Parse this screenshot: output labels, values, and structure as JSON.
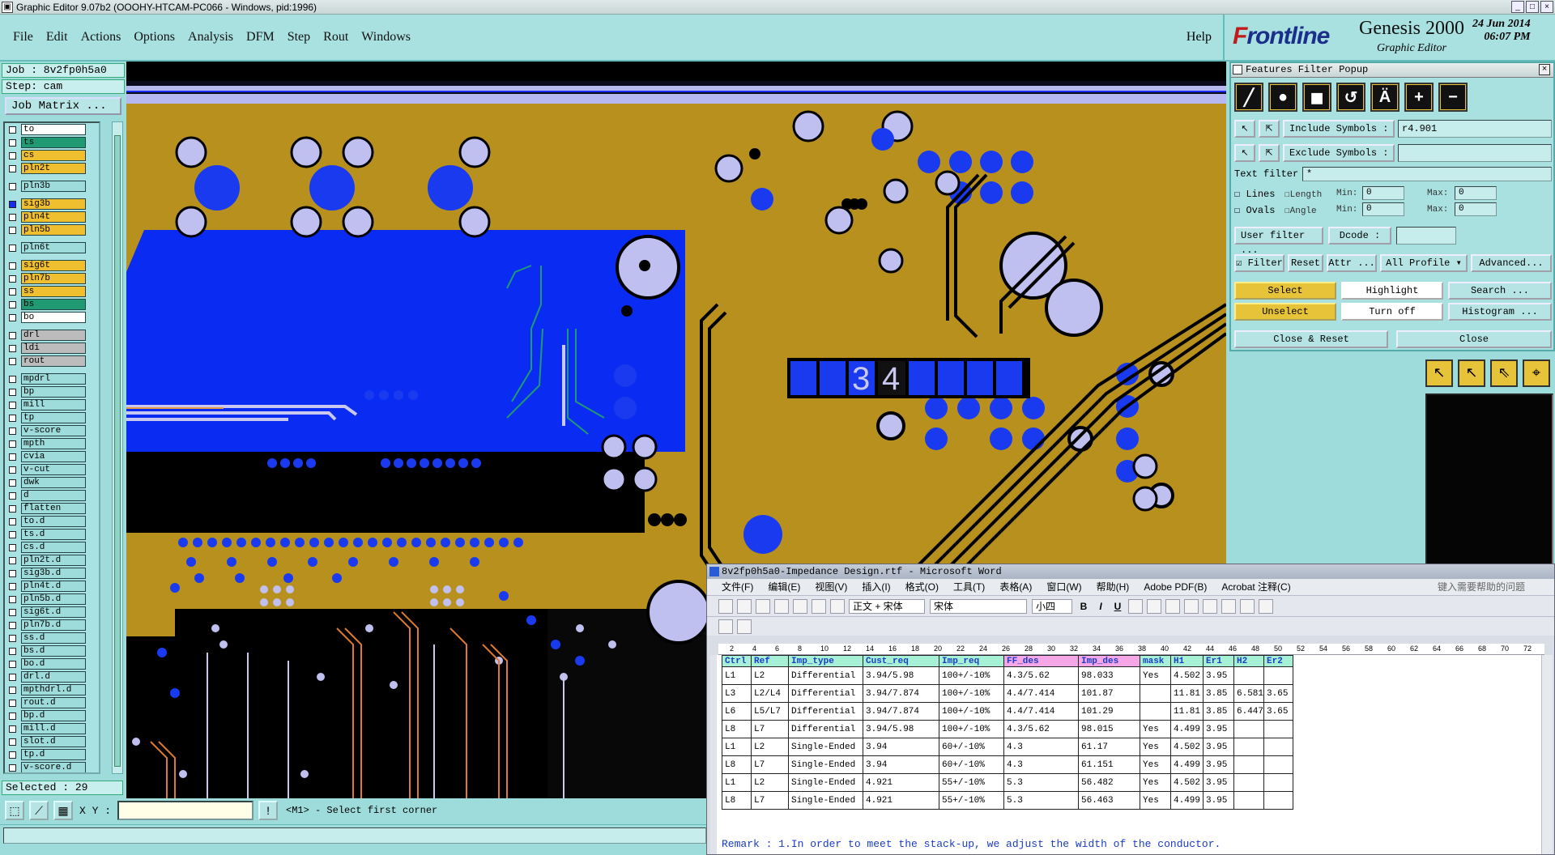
{
  "titlebar": {
    "title": "Graphic Editor 9.07b2 (OOOHY-HTCAM-PC066 - Windows, pid:1996)"
  },
  "menu": {
    "items": [
      "File",
      "Edit",
      "Actions",
      "Options",
      "Analysis",
      "DFM",
      "Step",
      "Rout",
      "Windows"
    ],
    "help": "Help"
  },
  "brand": {
    "logo_f": "F",
    "logo_rest": "rontline",
    "product": "Genesis 2000",
    "subtitle": "Graphic Editor",
    "date": "24 Jun 2014",
    "time": "06:07 PM"
  },
  "left": {
    "job": "Job : 8v2fp0h5a0",
    "step": "Step: cam",
    "job_matrix": "Job Matrix ...",
    "selected": "Selected : 29",
    "layers": [
      {
        "name": "to",
        "color": "#ffffff",
        "gap": false
      },
      {
        "name": "ts",
        "color": "#1f9a73",
        "gap": false
      },
      {
        "name": "cs",
        "color": "#f0bf30",
        "gap": false
      },
      {
        "name": "pln2t",
        "color": "#f0bf30",
        "gap": false
      },
      {
        "name": "pln3b",
        "color": "#9edcdc",
        "gap": true
      },
      {
        "name": "sig3b",
        "color": "#f0bf30",
        "gap": true,
        "active": true
      },
      {
        "name": "pln4t",
        "color": "#f0bf30",
        "gap": false
      },
      {
        "name": "pln5b",
        "color": "#f0bf30",
        "gap": false
      },
      {
        "name": "pln6t",
        "color": "#9edcdc",
        "gap": true
      },
      {
        "name": "sig6t",
        "color": "#f0bf30",
        "gap": true
      },
      {
        "name": "pln7b",
        "color": "#f0bf30",
        "gap": false
      },
      {
        "name": "ss",
        "color": "#f0bf30",
        "gap": false
      },
      {
        "name": "bs",
        "color": "#1f9a73",
        "gap": false
      },
      {
        "name": "bo",
        "color": "#ffffff",
        "gap": false
      },
      {
        "name": "drl",
        "color": "#bcbcbc",
        "gap": true
      },
      {
        "name": "ldi",
        "color": "#bcbcbc",
        "gap": false
      },
      {
        "name": "rout",
        "color": "#bcbcbc",
        "gap": false
      },
      {
        "name": "mpdrl",
        "color": "#9edcdc",
        "gap": true
      },
      {
        "name": "bp",
        "color": "#9edcdc",
        "gap": false
      },
      {
        "name": "mill",
        "color": "#9edcdc",
        "gap": false
      },
      {
        "name": "tp",
        "color": "#9edcdc",
        "gap": false
      },
      {
        "name": "v-score",
        "color": "#9edcdc",
        "gap": false
      },
      {
        "name": "mpth",
        "color": "#9edcdc",
        "gap": false
      },
      {
        "name": "cvia",
        "color": "#9edcdc",
        "gap": false
      },
      {
        "name": "v-cut",
        "color": "#9edcdc",
        "gap": false
      },
      {
        "name": "dwk",
        "color": "#9edcdc",
        "gap": false
      },
      {
        "name": "d",
        "color": "#9edcdc",
        "gap": false
      },
      {
        "name": "flatten",
        "color": "#9edcdc",
        "gap": false
      },
      {
        "name": "to.d",
        "color": "#9edcdc",
        "gap": false
      },
      {
        "name": "ts.d",
        "color": "#9edcdc",
        "gap": false
      },
      {
        "name": "cs.d",
        "color": "#9edcdc",
        "gap": false
      },
      {
        "name": "pln2t.d",
        "color": "#9edcdc",
        "gap": false
      },
      {
        "name": "sig3b.d",
        "color": "#9edcdc",
        "gap": false
      },
      {
        "name": "pln4t.d",
        "color": "#9edcdc",
        "gap": false
      },
      {
        "name": "pln5b.d",
        "color": "#9edcdc",
        "gap": false
      },
      {
        "name": "sig6t.d",
        "color": "#9edcdc",
        "gap": false
      },
      {
        "name": "pln7b.d",
        "color": "#9edcdc",
        "gap": false
      },
      {
        "name": "ss.d",
        "color": "#9edcdc",
        "gap": false
      },
      {
        "name": "bs.d",
        "color": "#9edcdc",
        "gap": false
      },
      {
        "name": "bo.d",
        "color": "#9edcdc",
        "gap": false
      },
      {
        "name": "drl.d",
        "color": "#9edcdc",
        "gap": false
      },
      {
        "name": "mpthdrl.d",
        "color": "#9edcdc",
        "gap": false
      },
      {
        "name": "rout.d",
        "color": "#9edcdc",
        "gap": false
      },
      {
        "name": "bp.d",
        "color": "#9edcdc",
        "gap": false
      },
      {
        "name": "mill.d",
        "color": "#9edcdc",
        "gap": false
      },
      {
        "name": "slot.d",
        "color": "#9edcdc",
        "gap": false
      },
      {
        "name": "tp.d",
        "color": "#9edcdc",
        "gap": false
      },
      {
        "name": "v-score.d",
        "color": "#9edcdc",
        "gap": false
      }
    ]
  },
  "bottom": {
    "xy_label": "X Y :",
    "xy_value": "",
    "message": "<M1> - Select first corner"
  },
  "canvas": {
    "label_3": "3",
    "label_4": "4"
  },
  "ffp": {
    "title": "Features Filter Popup",
    "include_label": "Include Symbols :",
    "include_value": "r4.901",
    "exclude_label": "Exclude Symbols :",
    "exclude_value": "",
    "text_filter_label": "Text filter",
    "text_filter_value": "*",
    "lines": "Lines",
    "ovals": "Ovals",
    "length": "Length",
    "angle": "Angle",
    "min": "Min:",
    "max": "Max:",
    "min_len": "0",
    "max_len": "0",
    "min_ang": "0",
    "max_ang": "0",
    "user_filter": "User filter ...",
    "dcode": "Dcode :",
    "filter": "Filter",
    "reset": "Reset",
    "attr": "Attr ...",
    "all_profile": "All Profile",
    "advanced": "Advanced...",
    "select": "Select",
    "highlight": "Highlight",
    "search": "Search ...",
    "unselect": "Unselect",
    "turn_off": "Turn off",
    "histogram": "Histogram ...",
    "close_reset": "Close & Reset",
    "close": "Close"
  },
  "word": {
    "title": "8v2fp0h5a0-Impedance Design.rtf - Microsoft Word",
    "menu": [
      "文件(F)",
      "编辑(E)",
      "视图(V)",
      "插入(I)",
      "格式(O)",
      "工具(T)",
      "表格(A)",
      "窗口(W)",
      "帮助(H)",
      "Adobe PDF(B)",
      "Acrobat 注释(C)"
    ],
    "ask": "键入需要帮助的问题",
    "style": "正文 + 宋体",
    "font": "宋体",
    "size": "小四",
    "ruler": [
      "2",
      "4",
      "6",
      "8",
      "10",
      "12",
      "14",
      "16",
      "18",
      "20",
      "22",
      "24",
      "26",
      "28",
      "30",
      "32",
      "34",
      "36",
      "38",
      "40",
      "42",
      "44",
      "46",
      "48",
      "50",
      "52",
      "54",
      "56",
      "58",
      "60",
      "62",
      "64",
      "66",
      "68",
      "70",
      "72"
    ],
    "table_headers": [
      "Ctrl",
      "Ref",
      "Imp_type",
      "Cust_req",
      "Imp_req",
      "FF_des",
      "Imp_des",
      "mask",
      "H1",
      "Er1",
      "H2",
      "Er2"
    ],
    "table_rows": [
      [
        "L1",
        "L2",
        "Differential",
        "3.94/5.98",
        "100+/-10%",
        "4.3/5.62",
        "98.033",
        "Yes",
        "4.502",
        "3.95",
        "",
        ""
      ],
      [
        "L3",
        "L2/L4",
        "Differential",
        "3.94/7.874",
        "100+/-10%",
        "4.4/7.414",
        "101.87",
        "",
        "11.81",
        "3.85",
        "6.581",
        "3.65"
      ],
      [
        "L6",
        "L5/L7",
        "Differential",
        "3.94/7.874",
        "100+/-10%",
        "4.4/7.414",
        "101.29",
        "",
        "11.81",
        "3.85",
        "6.447",
        "3.65"
      ],
      [
        "L8",
        "L7",
        "Differential",
        "3.94/5.98",
        "100+/-10%",
        "4.3/5.62",
        "98.015",
        "Yes",
        "4.499",
        "3.95",
        "",
        ""
      ],
      [
        "L1",
        "L2",
        "Single-Ended",
        "3.94",
        "60+/-10%",
        "4.3",
        "61.17",
        "Yes",
        "4.502",
        "3.95",
        "",
        ""
      ],
      [
        "L8",
        "L7",
        "Single-Ended",
        "3.94",
        "60+/-10%",
        "4.3",
        "61.151",
        "Yes",
        "4.499",
        "3.95",
        "",
        ""
      ],
      [
        "L1",
        "L2",
        "Single-Ended",
        "4.921",
        "55+/-10%",
        "5.3",
        "56.482",
        "Yes",
        "4.502",
        "3.95",
        "",
        ""
      ],
      [
        "L8",
        "L7",
        "Single-Ended",
        "4.921",
        "55+/-10%",
        "5.3",
        "56.463",
        "Yes",
        "4.499",
        "3.95",
        "",
        ""
      ]
    ],
    "remark": "Remark : 1.In order to meet the stack-up, we adjust the width of the conductor."
  },
  "colors": {
    "board": "#b8901d",
    "plane": "#0a2cf2",
    "pad": "#1a3af0",
    "drill": "#c0c0f0",
    "trace": "#070707",
    "void": "#000000"
  }
}
